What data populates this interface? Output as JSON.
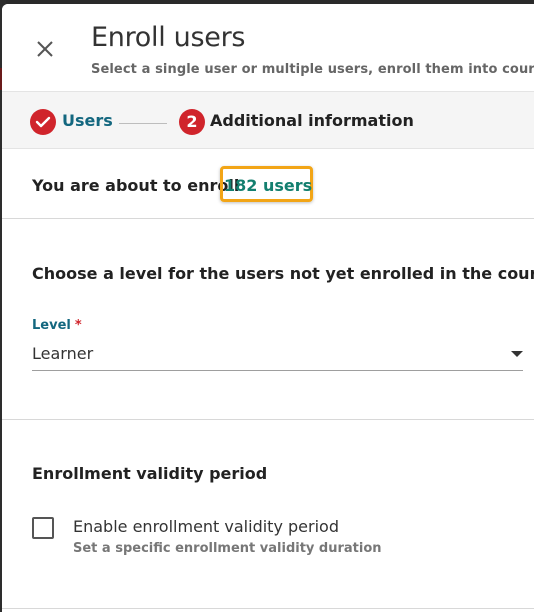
{
  "dialog": {
    "title": "Enroll users",
    "subtitle": "Select a single user or multiple users, enroll them into courses, t"
  },
  "stepper": {
    "steps": [
      {
        "label": "Users",
        "state": "completed"
      },
      {
        "number": "2",
        "label": "Additional information",
        "state": "active"
      }
    ]
  },
  "summary": {
    "prefix": "You are about to enroll",
    "count_link": "182 users"
  },
  "level_section": {
    "heading": "Choose a level for the users not yet enrolled in the course",
    "field_label": "Level",
    "required_mark": "*",
    "selected_value": "Learner"
  },
  "validity_section": {
    "heading": "Enrollment validity period",
    "checkbox_label": "Enable enrollment validity period",
    "checkbox_help": "Set a specific enrollment validity duration",
    "checked": false
  },
  "colors": {
    "accent_teal": "#137f6f",
    "step_red": "#d0242b",
    "highlight_orange": "#f2a516"
  }
}
